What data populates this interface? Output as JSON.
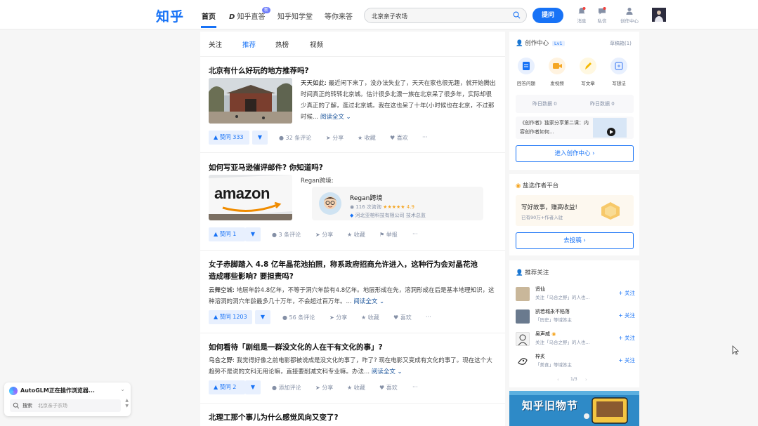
{
  "header": {
    "logo": "知乎",
    "nav": [
      "首页",
      "知乎直答",
      "知乎知学堂",
      "等你来答"
    ],
    "new_badge": "新",
    "search_value": "北京亲子农场",
    "ask_label": "提问",
    "icons": [
      {
        "name": "bell-icon",
        "label": "消息",
        "count": "2"
      },
      {
        "name": "message-icon",
        "label": "私信",
        "count": "2"
      },
      {
        "name": "creator-icon",
        "label": "创作中心"
      }
    ]
  },
  "feed": {
    "tabs": [
      "关注",
      "推荐",
      "热榜",
      "视频"
    ],
    "items": [
      {
        "title": "北京有什么好玩的地方推荐吗?",
        "author": "天天如此:",
        "excerpt": "最近闲下来了，没办法失业了，天天在家也很无趣，就开始腾出时间真正的转转北京城。估计很多北漂一族在北京呆了很多年，实际却很少真正的了解，逛过北京城。我在这也呆了十年(小时候也在北京，不过那时候...",
        "readmore": "阅读全文",
        "vote": "赞同 333",
        "comments": "32 条评论",
        "share": "分享",
        "collect": "收藏",
        "like": "喜欢",
        "more": "···"
      },
      {
        "title": "如何写亚马逊催评邮件? 你知道吗?",
        "author": "Regan跨境:",
        "card_name": "Regan跨境",
        "card_meta": "116 次咨询",
        "card_rating": "4.9",
        "card_company": "河北亚榕科技有限公司 技术总监",
        "thumb_text": "amazon",
        "vote": "赞同 1",
        "comments": "3 条评论",
        "share": "分享",
        "collect": "收藏",
        "report": "举报",
        "more": "···"
      },
      {
        "title": "女子赤脚踏入 4.8 亿年晶花池拍照，称系政府招商允许进入，这种行为会对晶花池",
        "title2": "造成哪些影响? 要担责吗?",
        "author": "云舞空城:",
        "excerpt": "地层年龄4.8亿年，不等于洞穴年龄有4.8亿年。地层形成在先，溶洞形成在后是基本地理知识，这种溶洞的洞穴年龄最多几十万年，不会超过百万年。...",
        "readmore": "阅读全文",
        "vote": "赞同 1203",
        "comments": "56 条评论",
        "share": "分享",
        "collect": "收藏",
        "like": "喜欢",
        "more": "···"
      },
      {
        "title": "如何看待「剧组是一群没文化的人在干有文化的事」?",
        "author": "乌合之野:",
        "excerpt": "我觉得好像之前电影都被说成是没文化的事了，咋了? 现在电影又变成有文化的事了。现在这个大趋势不是说的文科无用论嘛，直接要削减文科专业嘛。办法...",
        "readmore": "阅读全文",
        "vote": "赞同 2",
        "comments": "添加评论",
        "share": "分享",
        "collect": "收藏",
        "like": "喜欢",
        "more": "···"
      },
      {
        "title": "北理工那个事儿为什么感觉风向又变了?"
      }
    ]
  },
  "sidebar": {
    "creation": {
      "title": "创作中心",
      "level": "Lv1",
      "drafts": "草稿箱(1)",
      "actions": [
        "回答问题",
        "发视频",
        "写文章",
        "写想法"
      ],
      "yesterday_read": "昨日数据 0",
      "yesterday_like": "昨日数据 0",
      "promo_text": "《创作者》独家分享第二课：内容创作者如何...",
      "enter_label": "进入创作中心 ›"
    },
    "platform": {
      "title": "盐选作者平台",
      "slogan": "写好故事，赚高收益!",
      "sub": "已有90万+作者入驻",
      "btn": "去投稿 ›"
    },
    "follow": {
      "title": "推荐关注",
      "items": [
        {
          "name": "贤仙",
          "desc": "关注「乌合之野」的人也...",
          "btn": "+ 关注"
        },
        {
          "name": "凯若城永不陷落",
          "desc": "「历史」等域答主",
          "btn": "+ 关注"
        },
        {
          "name": "吴声威",
          "desc": "关注「乌合之野」的人也...",
          "btn": "+ 关注"
        },
        {
          "name": "梓炙",
          "desc": "「美食」等域答主",
          "btn": "+ 关注"
        }
      ],
      "pager": "1/3"
    },
    "banner": "知乎旧物节"
  },
  "overlay": {
    "title": "AutoGLM正在操作浏览器...",
    "sub_label": "搜索",
    "sub_value": "北京亲子农场"
  },
  "colors": {
    "brand": "#1772f6",
    "vote_bg": "#e8f0fe",
    "page_bg": "#f6f6f6"
  }
}
